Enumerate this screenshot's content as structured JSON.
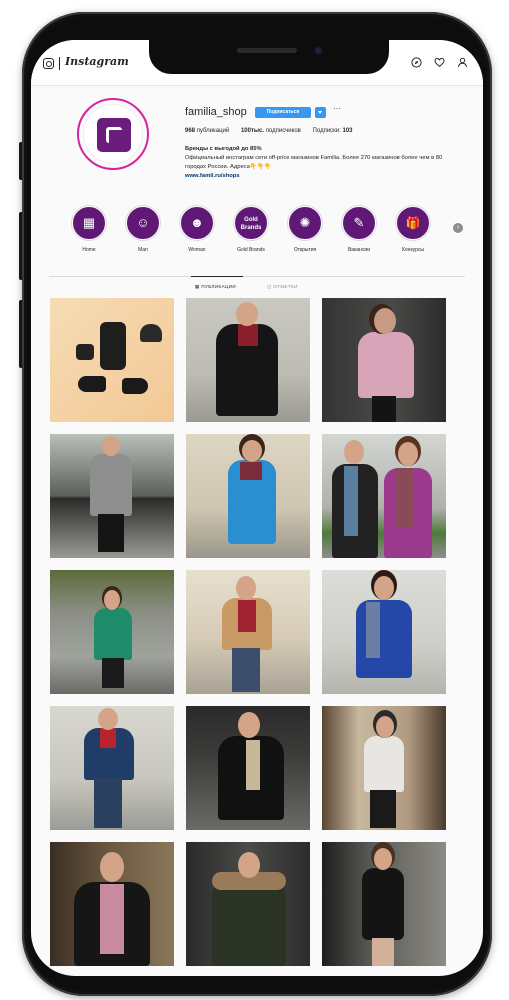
{
  "topbar": {
    "logo_text": "Instagram",
    "icons": [
      "instagram-glyph-icon",
      "compass-icon",
      "heart-icon",
      "user-icon"
    ]
  },
  "profile": {
    "username": "familia_shop",
    "follow_label": "Подписаться",
    "more_label": "···",
    "stats": {
      "posts_value": "968",
      "posts_label": "публикаций",
      "followers_value": "100тыс.",
      "followers_label": "подписчиков",
      "following_label": "Подписки:",
      "following_value": "103"
    },
    "bio": {
      "name": "Бренды с выгодой до 85%",
      "text": "Официальный инстаграм сети off-price магазинов Familia. Более 270 магазинов более чем в 80 городах России. Адреса👇👇👇",
      "link": "www.famil.ru/shops"
    }
  },
  "highlights": [
    {
      "label": "Home",
      "icon": "home-furniture-icon",
      "glyph": "▦"
    },
    {
      "label": "Man",
      "icon": "man-face-icon",
      "glyph": "☺"
    },
    {
      "label": "Woman",
      "icon": "woman-face-icon",
      "glyph": "☻"
    },
    {
      "label": "Gold Brands",
      "icon": "gold-brands-text-icon",
      "glyph": "Gold Brands"
    },
    {
      "label": "Открытия",
      "icon": "celebration-icon",
      "glyph": "✺"
    },
    {
      "label": "Вакансии",
      "icon": "document-pen-icon",
      "glyph": "✎"
    },
    {
      "label": "Конкурсы",
      "icon": "gift-icon",
      "glyph": "🎁"
    }
  ],
  "tabs": [
    {
      "label": "ПУБЛИКАЦИИ",
      "icon": "grid-icon",
      "active": true
    },
    {
      "label": "ОТМЕТКИ",
      "icon": "tag-icon",
      "active": false
    }
  ],
  "colors": {
    "brand_purple": "#5f1875",
    "follow_blue": "#3897f0",
    "avatar_ring": "#d6249f"
  }
}
